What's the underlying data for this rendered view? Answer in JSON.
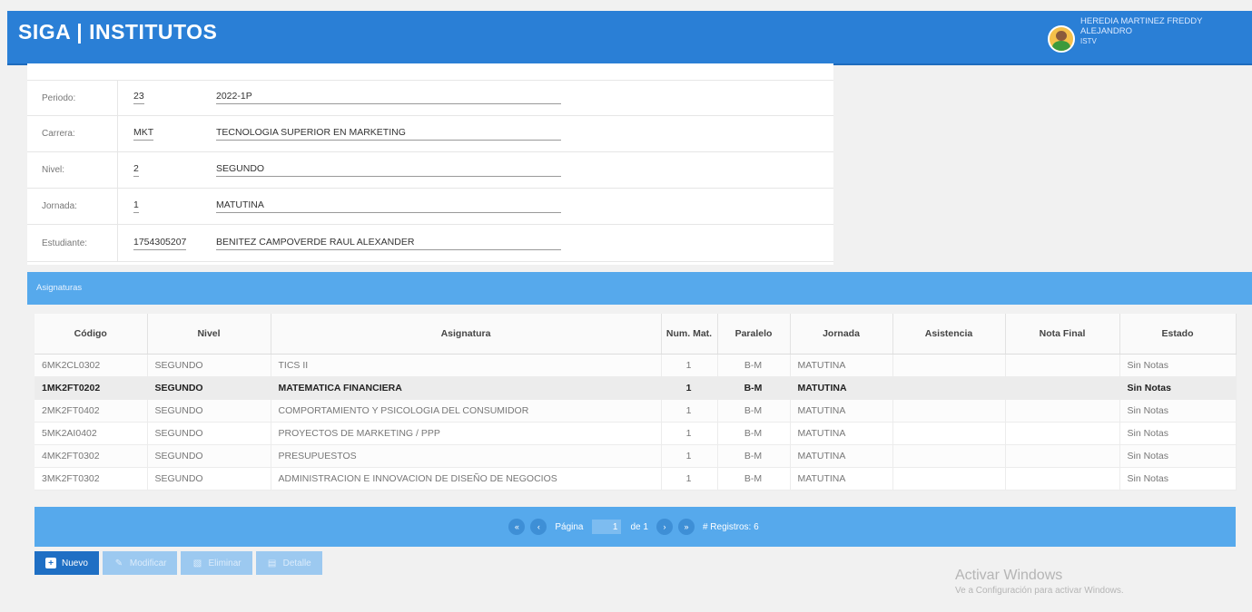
{
  "app": {
    "title": "SIGA | INSTITUTOS"
  },
  "user": {
    "name_line1": "HEREDIA MARTINEZ FREDDY",
    "name_line2": "ALEJANDRO",
    "org": "ISTV"
  },
  "form": {
    "periodo": {
      "label": "Periodo:",
      "code": "23",
      "desc": "2022-1P"
    },
    "carrera": {
      "label": "Carrera:",
      "code": "MKT",
      "desc": "TECNOLOGIA SUPERIOR EN MARKETING"
    },
    "nivel": {
      "label": "Nivel:",
      "code": "2",
      "desc": "SEGUNDO"
    },
    "jornada": {
      "label": "Jornada:",
      "code": "1",
      "desc": "MATUTINA"
    },
    "estudiante": {
      "label": "Estudiante:",
      "code": "1754305207",
      "desc": "BENITEZ CAMPOVERDE RAUL ALEXANDER"
    }
  },
  "section": {
    "title": "Asignaturas"
  },
  "table": {
    "headers": [
      "Código",
      "Nivel",
      "Asignatura",
      "Num. Mat.",
      "Paralelo",
      "Jornada",
      "Asistencia",
      "Nota Final",
      "Estado"
    ],
    "rows": [
      [
        "6MK2CL0302",
        "SEGUNDO",
        "TICS II",
        "1",
        "B-M",
        "MATUTINA",
        "",
        "",
        "Sin Notas"
      ],
      [
        "1MK2FT0202",
        "SEGUNDO",
        "MATEMATICA FINANCIERA",
        "1",
        "B-M",
        "MATUTINA",
        "",
        "",
        "Sin Notas"
      ],
      [
        "2MK2FT0402",
        "SEGUNDO",
        "COMPORTAMIENTO Y PSICOLOGIA DEL CONSUMIDOR",
        "1",
        "B-M",
        "MATUTINA",
        "",
        "",
        "Sin Notas"
      ],
      [
        "5MK2AI0402",
        "SEGUNDO",
        "PROYECTOS DE MARKETING / PPP",
        "1",
        "B-M",
        "MATUTINA",
        "",
        "",
        "Sin Notas"
      ],
      [
        "4MK2FT0302",
        "SEGUNDO",
        "PRESUPUESTOS",
        "1",
        "B-M",
        "MATUTINA",
        "",
        "",
        "Sin Notas"
      ],
      [
        "3MK2FT0302",
        "SEGUNDO",
        "ADMINISTRACION E INNOVACION DE DISEÑO DE NEGOCIOS",
        "1",
        "B-M",
        "MATUTINA",
        "",
        "",
        "Sin Notas"
      ]
    ]
  },
  "pager": {
    "page_label": "Página",
    "page_value": "1",
    "of_label": "de 1",
    "records": "# Registros: 6"
  },
  "actions": {
    "nuevo": "Nuevo",
    "modificar": "Modificar",
    "eliminar": "Eliminar",
    "detalle": "Detalle"
  },
  "watermark": {
    "line1": "Activar Windows",
    "line2": "Ve a Configuración para activar Windows."
  },
  "colors": {
    "header": "#2a7fd6",
    "section": "#56a9ec",
    "primary_button": "#1f6fc4"
  }
}
